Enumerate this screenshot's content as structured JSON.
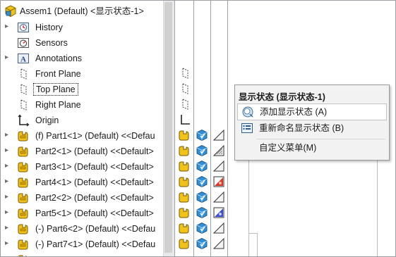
{
  "tree": {
    "root_label": "Assem1 (Default) <显示状态-1>",
    "items": [
      {
        "label": "History",
        "icon": "history-icon",
        "expandable": true
      },
      {
        "label": "Sensors",
        "icon": "sensors-icon",
        "expandable": false
      },
      {
        "label": "Annotations",
        "icon": "annotations-icon",
        "expandable": true
      },
      {
        "label": "Front Plane",
        "icon": "plane-icon",
        "expandable": false
      },
      {
        "label": "Top Plane",
        "icon": "plane-icon",
        "expandable": false
      },
      {
        "label": "Right Plane",
        "icon": "plane-icon",
        "expandable": false
      },
      {
        "label": "Origin",
        "icon": "origin-icon",
        "expandable": false
      },
      {
        "label": "(f) Part1<1> (Default) <<Defau",
        "icon": "part-icon",
        "expandable": true
      },
      {
        "label": "Part2<1> (Default) <<Default>",
        "icon": "part-icon",
        "expandable": true
      },
      {
        "label": "Part3<1> (Default) <<Default>",
        "icon": "part-icon",
        "expandable": true
      },
      {
        "label": "Part4<1> (Default) <<Default>",
        "icon": "part-icon",
        "expandable": true
      },
      {
        "label": "Part2<2> (Default) <<Default>",
        "icon": "part-icon",
        "expandable": true
      },
      {
        "label": "Part5<1> (Default) <<Default>",
        "icon": "part-icon",
        "expandable": true
      },
      {
        "label": "(-) Part6<2> (Default) <<Defau",
        "icon": "part-icon",
        "expandable": true
      },
      {
        "label": "(-) Part7<1> (Default) <<Defau",
        "icon": "part-icon",
        "expandable": true
      }
    ]
  },
  "context_menu": {
    "title": "显示状态 (显示状态-1)",
    "items": [
      {
        "label": "添加显示状态 (A)",
        "icon": "add-display-state-icon"
      },
      {
        "label": "重新命名显示状态 (B)",
        "icon": "rename-display-state-icon"
      },
      {
        "label": "自定义菜单(M)",
        "icon": ""
      }
    ]
  },
  "colors": {
    "part_yellow": "#f2c21a",
    "cube_blue": "#2f8fd8",
    "red_swatch": "#d83a2a",
    "blue_swatch": "#3b4fd0"
  },
  "display_swatches": [
    "plain",
    "striped",
    "plain",
    "red",
    "plain",
    "blue",
    "plain",
    "plain"
  ]
}
